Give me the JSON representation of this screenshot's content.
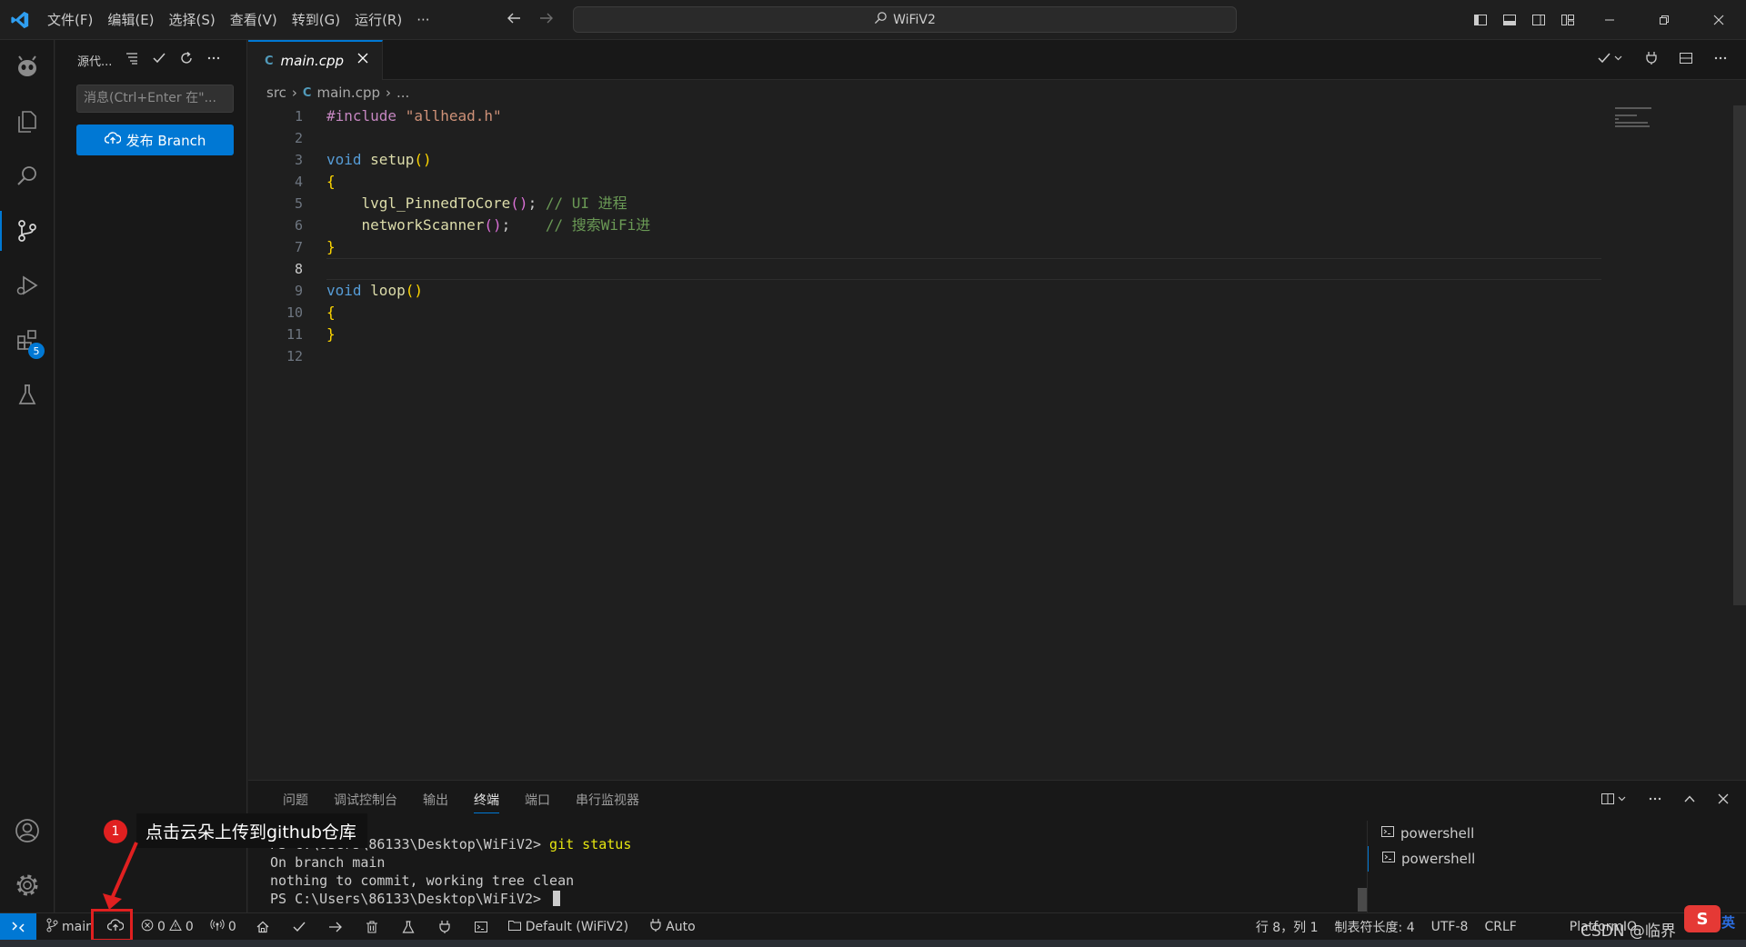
{
  "titlebar": {
    "menu": [
      "文件(F)",
      "编辑(E)",
      "选择(S)",
      "查看(V)",
      "转到(G)",
      "运行(R)",
      "···"
    ],
    "search_text": "WiFiV2"
  },
  "activity": {
    "extensions_badge": "5"
  },
  "sidebar": {
    "title": "源代...",
    "message_placeholder": "消息(Ctrl+Enter 在\"...",
    "publish_label": "发布 Branch"
  },
  "editor": {
    "tab_label": "main.cpp",
    "breadcrumb": [
      "src",
      "main.cpp",
      "..."
    ],
    "line_numbers": [
      "1",
      "2",
      "3",
      "4",
      "5",
      "6",
      "7",
      "8",
      "9",
      "10",
      "11",
      "12"
    ],
    "current_line": "8",
    "code": {
      "l1_pp": "#include",
      "l1_str": "\"allhead.h\"",
      "l3_kw": "void",
      "l3_fn": "setup",
      "l5_fn": "lvgl_PinnedToCore",
      "l5_cm": "// UI 进程",
      "l6_fn": "networkScanner",
      "l6_cm": "// 搜索WiFi进",
      "l9_kw": "void",
      "l9_fn": "loop"
    }
  },
  "panel": {
    "tabs": [
      "问题",
      "调试控制台",
      "输出",
      "终端",
      "端口",
      "串行监视器"
    ],
    "active_tab": "终端",
    "terminal_lines": {
      "l1_prompt": "PS C:\\Users\\86133\\Desktop\\WiFiV2> ",
      "l1_cmd": "git status",
      "l2": "On branch main",
      "l3": "nothing to commit, working tree clean",
      "l4_prompt": "PS C:\\Users\\86133\\Desktop\\WiFiV2> "
    },
    "terminals": [
      "powershell",
      "powershell"
    ]
  },
  "statusbar": {
    "branch": "main",
    "errors": "0",
    "warnings": "0",
    "ports": "0",
    "env": "Default (WiFiV2)",
    "auto": "Auto",
    "position": "行 8，列 1",
    "tab_size": "制表符长度: 4",
    "encoding": "UTF-8",
    "eol": "CRLF",
    "platform": "PlatformIO"
  },
  "annotation": {
    "step": "1",
    "text": "点击云朵上传到github仓库"
  },
  "watermark": "CSDN @临界",
  "ime": {
    "icon": "S",
    "lang": "英"
  },
  "colors": {
    "accent": "#0078d4",
    "annotation": "#e02020"
  }
}
